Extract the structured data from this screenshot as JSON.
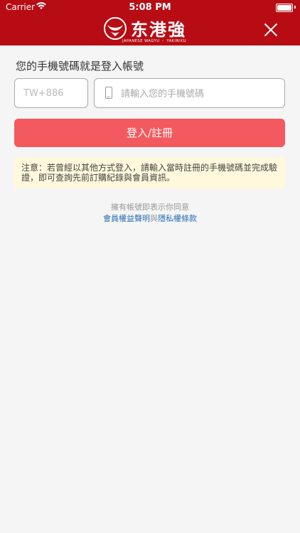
{
  "status_bar": {
    "carrier": "Carrier",
    "time": "5:08 PM"
  },
  "header": {
    "logo_text": "东港強",
    "logo_subtitle": "JAPANESE WAGYU ・ YAKINIKU",
    "close_icon": "close-icon",
    "background_color": "#b80c14"
  },
  "form": {
    "label": "您的手機號碼就是登入帳號",
    "country_code_placeholder": "TW+886",
    "phone_placeholder": "請輸入您的手機號碼",
    "phone_icon": "phone-icon",
    "submit_label": "登入/註冊",
    "submit_color": "#f25a5f"
  },
  "notice": {
    "text": "注意：若曾經以其他方式登入，請輸入當時註冊的手機號碼並完成驗證，即可查詢先前訂購紀錄與會員資訊。"
  },
  "agreement": {
    "prefix": "擁有帳號即表示你同意",
    "terms_link": "會員權益聲明",
    "conjunction": "與",
    "privacy_link": "隱私權條款",
    "link_color": "#2a6db5"
  }
}
